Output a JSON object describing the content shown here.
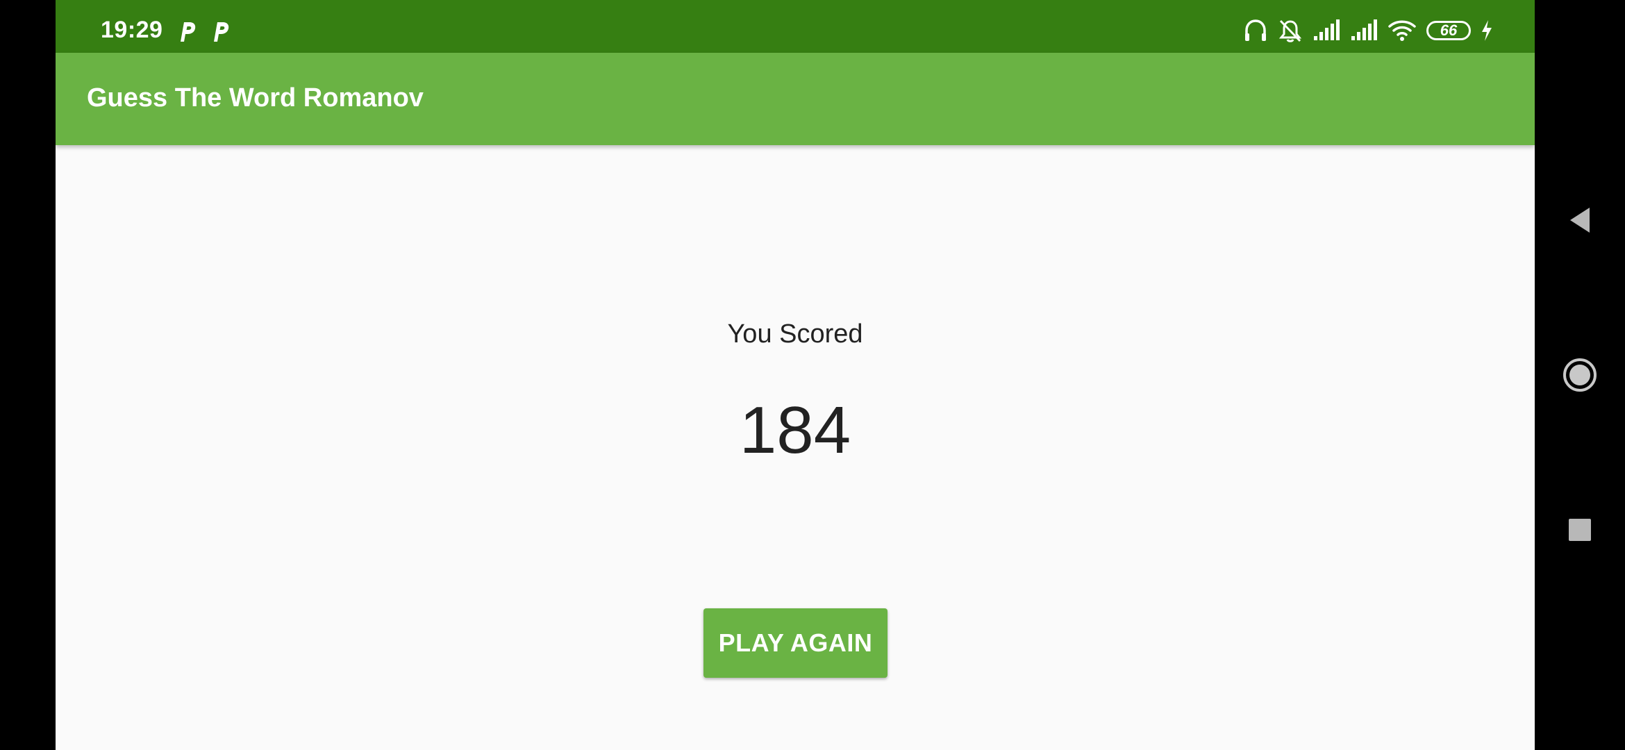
{
  "status_bar": {
    "time": "19:29",
    "battery_level": "66",
    "notification_icons": [
      "parking-p-icon",
      "parking-p-icon"
    ],
    "system_icons": [
      "headphones-icon",
      "bell-muted-icon",
      "signal-icon",
      "signal-icon",
      "wifi-icon",
      "battery-icon",
      "charging-bolt-icon"
    ]
  },
  "toolbar": {
    "title": "Guess The Word Romanov"
  },
  "score": {
    "label": "You Scored",
    "value": "184"
  },
  "actions": {
    "play_again_label": "PLAY AGAIN"
  },
  "navigation": {
    "buttons": [
      "back-icon",
      "home-icon",
      "recents-icon"
    ]
  },
  "colors": {
    "status_bar": "#367f12",
    "primary": "#6ab344",
    "background": "#fafafa",
    "text": "#222222"
  }
}
